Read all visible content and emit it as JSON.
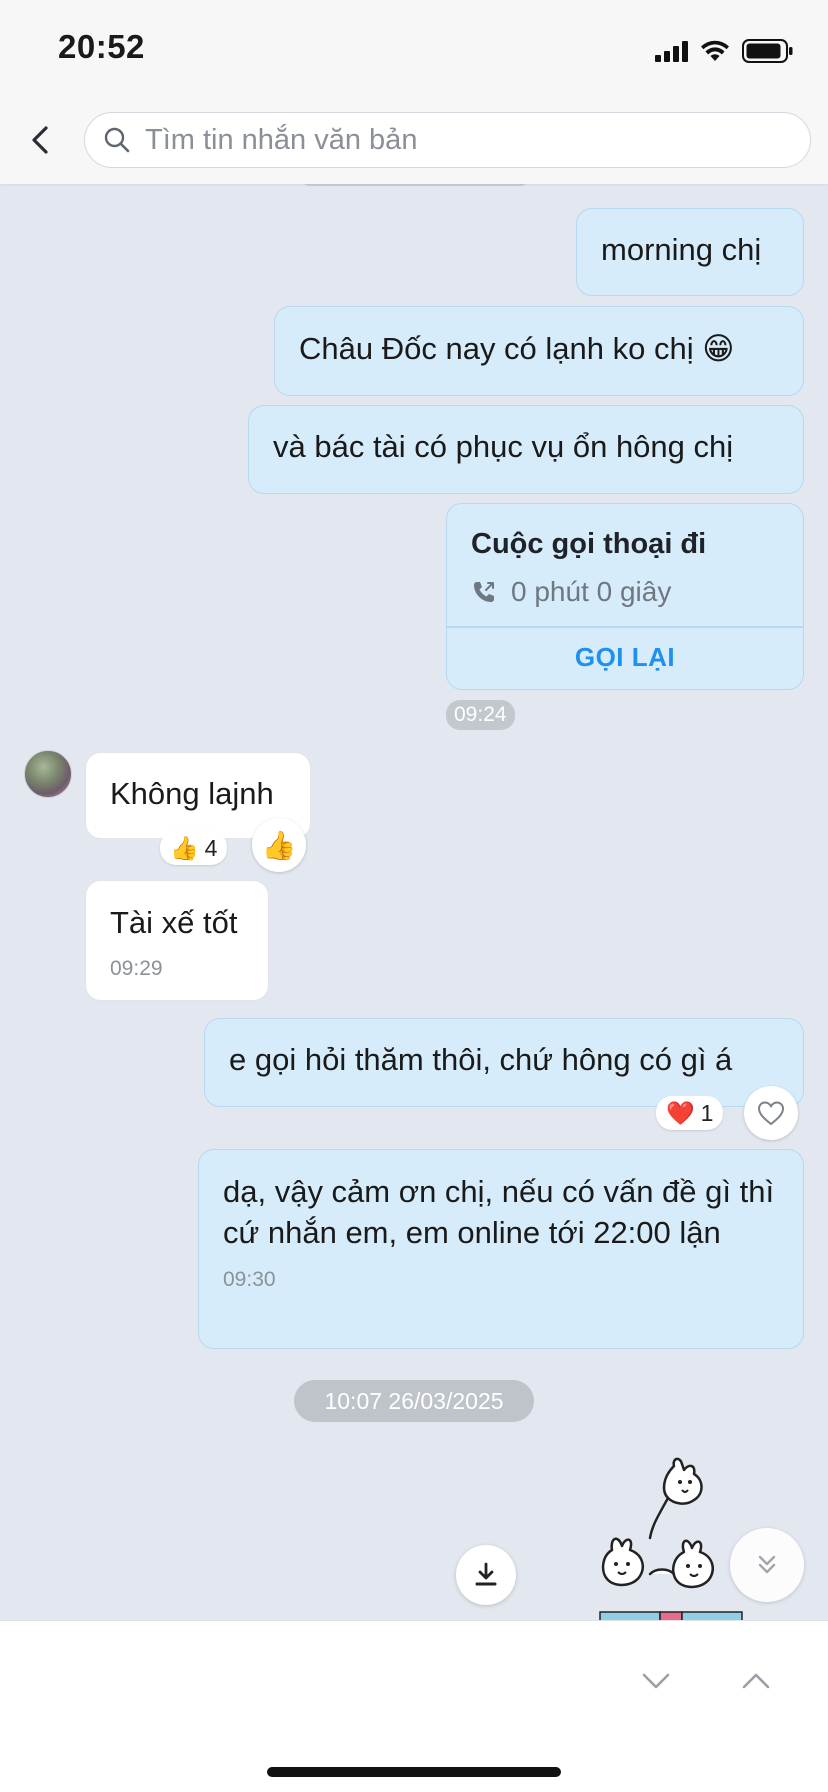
{
  "status_bar": {
    "time": "20:52"
  },
  "header": {
    "search_placeholder": "Tìm tin nhắn văn bản"
  },
  "messages": {
    "m1": {
      "text": "morning chị"
    },
    "m2": {
      "text": "Châu Đốc nay có lạnh ko chị 😁"
    },
    "m3": {
      "text": "và bác tài có phục vụ ổn hông chị"
    },
    "call": {
      "title": "Cuộc gọi thoại đi",
      "duration": "0 phút 0 giây",
      "action": "GỌI LẠI",
      "time": "09:24"
    },
    "m4": {
      "text": "Không lajnh",
      "reaction_emoji": "👍",
      "reaction_count": "4"
    },
    "m5": {
      "text": "Tài xế tốt",
      "time": "09:29"
    },
    "m6": {
      "text": "e gọi hỏi thăm thôi, chứ hông có gì á",
      "reaction_emoji": "❤️",
      "reaction_count": "1"
    },
    "m7": {
      "text": "dạ, vậy cảm ơn chị, nếu có vấn đề gì thì cứ nhắn em, em online tới 22:00 lận",
      "time": "09:30"
    }
  },
  "date_separator": "10:07 26/03/2025",
  "colors": {
    "background": "#e3e7ef",
    "outgoing_bubble": "#d6ecfb",
    "incoming_bubble": "#ffffff",
    "accent": "#1f8ff0"
  },
  "icons": [
    "back-chevron-icon",
    "search-icon",
    "phone-outgoing-icon",
    "thumbs-up-icon",
    "heart-icon",
    "download-icon",
    "scroll-down-icon",
    "chevron-down-icon",
    "chevron-up-icon"
  ]
}
